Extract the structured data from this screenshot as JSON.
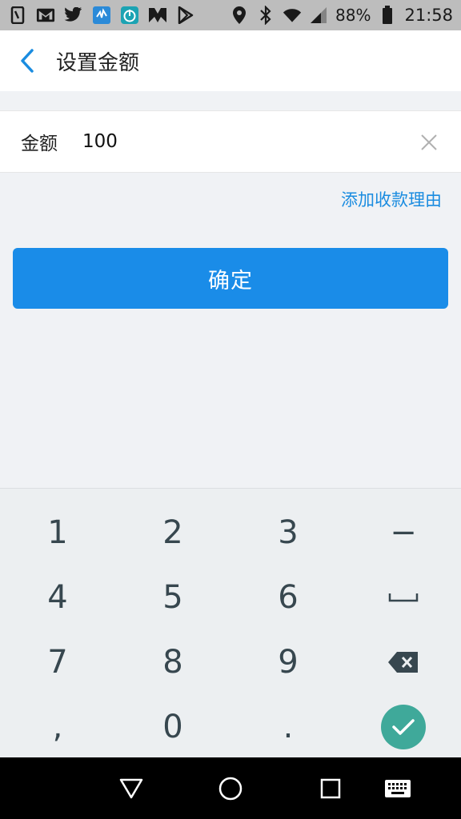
{
  "status_bar": {
    "battery": "88%",
    "time": "21:58",
    "left_icons": [
      "phone-icon",
      "gmail-icon",
      "twitter-icon",
      "app-icon",
      "timer-icon",
      "m-icon",
      "play-store-icon"
    ],
    "right_icons": [
      "location-icon",
      "bluetooth-icon",
      "wifi-icon",
      "signal-icon",
      "battery-icon"
    ]
  },
  "header": {
    "title": "设置金额",
    "back_icon": "chevron-left-icon"
  },
  "amount": {
    "label": "金额",
    "value": "100",
    "clear_icon": "close-icon"
  },
  "reason_link": "添加收款理由",
  "confirm_label": "确定",
  "keyboard": {
    "keys": [
      "1",
      "2",
      "3",
      "−",
      "4",
      "5",
      "6",
      "space",
      "7",
      "8",
      "9",
      "backspace",
      ",",
      "0",
      ".",
      "done"
    ],
    "labels": {
      "k1": "1",
      "k2": "2",
      "k3": "3",
      "minus": "−",
      "k4": "4",
      "k5": "5",
      "k6": "6",
      "k7": "7",
      "k8": "8",
      "k9": "9",
      "comma": ",",
      "k0": "0",
      "period": "."
    }
  },
  "nav_bar": {
    "icons": [
      "back-triangle-icon",
      "home-circle-icon",
      "recents-square-icon",
      "keyboard-icon"
    ]
  },
  "colors": {
    "accent": "#1a8ce8",
    "link": "#1a8ce0",
    "done_key": "#3fa99a",
    "background": "#f0f2f5"
  }
}
